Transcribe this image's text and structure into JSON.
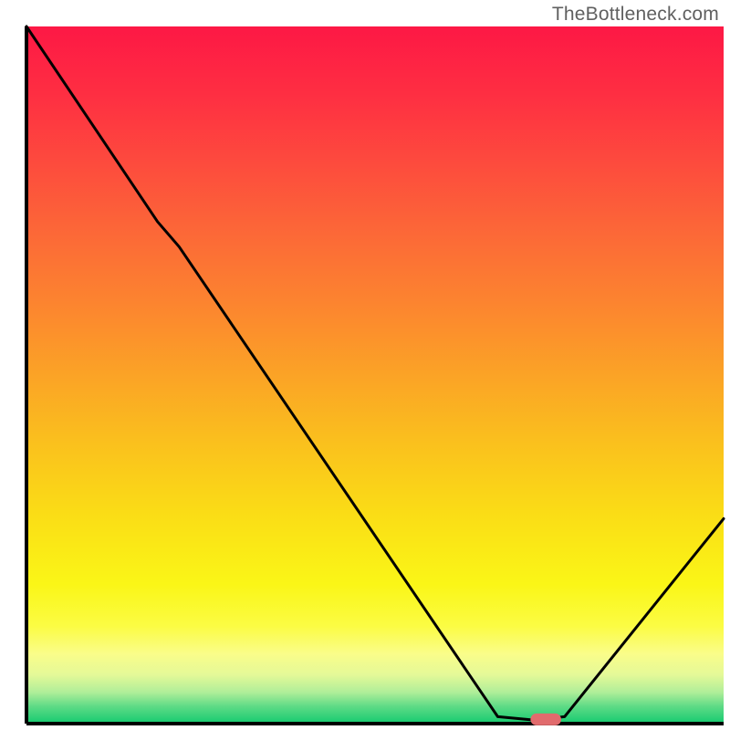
{
  "watermark": "TheBottleneck.com",
  "chart_data": {
    "type": "line",
    "title": "",
    "xlabel": "",
    "ylabel": "",
    "xlim": [
      0,
      100
    ],
    "ylim": [
      0,
      100
    ],
    "series": [
      {
        "name": "curve",
        "x": [
          0.0,
          18.8,
          21.9,
          67.6,
          72.8,
          77.2,
          100.0
        ],
        "y": [
          100.0,
          72.0,
          68.4,
          1.0,
          0.5,
          1.0,
          29.4
        ]
      }
    ],
    "marker": {
      "x_center": 74.5,
      "y_center": 0.6,
      "width": 4.4,
      "height": 1.7,
      "color": "#e16b6d"
    },
    "background_gradient_stops": [
      {
        "pos": 0.0,
        "color": "#fd1845"
      },
      {
        "pos": 0.1,
        "color": "#fe2f42"
      },
      {
        "pos": 0.2,
        "color": "#fd4c3d"
      },
      {
        "pos": 0.3,
        "color": "#fc6937"
      },
      {
        "pos": 0.4,
        "color": "#fc852f"
      },
      {
        "pos": 0.5,
        "color": "#fba326"
      },
      {
        "pos": 0.6,
        "color": "#fac11d"
      },
      {
        "pos": 0.7,
        "color": "#fadd16"
      },
      {
        "pos": 0.8,
        "color": "#faf617"
      },
      {
        "pos": 0.86,
        "color": "#fbfc43"
      },
      {
        "pos": 0.9,
        "color": "#fafd8a"
      },
      {
        "pos": 0.93,
        "color": "#e4f998"
      },
      {
        "pos": 0.955,
        "color": "#b0ee99"
      },
      {
        "pos": 0.975,
        "color": "#5fdb86"
      },
      {
        "pos": 1.0,
        "color": "#15ca70"
      }
    ],
    "axes_color": "#000000",
    "curve_color": "#000000"
  }
}
